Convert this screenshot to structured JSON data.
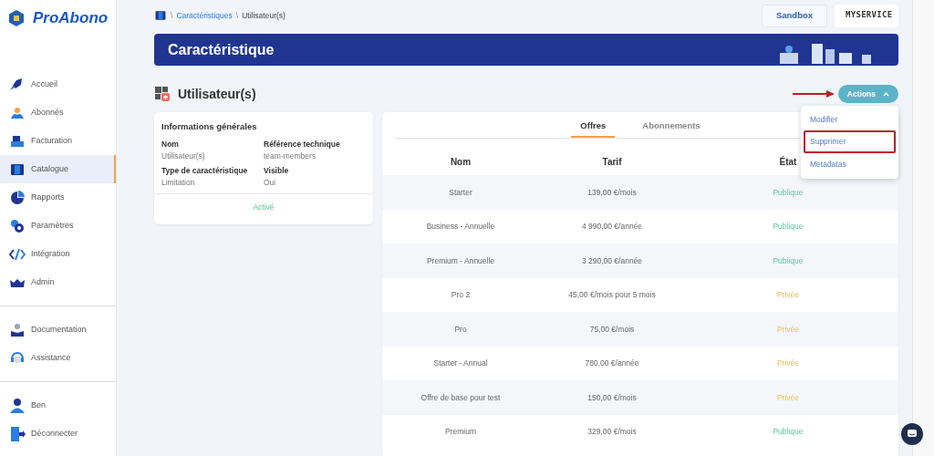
{
  "brand": "ProAbono",
  "sidebar": {
    "groups": [
      [
        {
          "label": "Accueil",
          "selected": false
        },
        {
          "label": "Abonnés",
          "selected": false
        },
        {
          "label": "Facturation",
          "selected": false
        },
        {
          "label": "Catalogue",
          "selected": true
        },
        {
          "label": "Rapports",
          "selected": false
        },
        {
          "label": "Paramètres",
          "selected": false
        },
        {
          "label": "Intégration",
          "selected": false
        },
        {
          "label": "Admin",
          "selected": false
        }
      ],
      [
        {
          "label": "Documentation",
          "selected": false
        },
        {
          "label": "Assistance",
          "selected": false
        }
      ],
      [
        {
          "label": "Ben",
          "selected": false
        },
        {
          "label": "Déconnecter",
          "selected": false
        }
      ]
    ]
  },
  "breadcrumb": [
    {
      "kind": "separator",
      "text": "\\"
    },
    {
      "kind": "link",
      "text": "Caractéristiques"
    },
    {
      "kind": "separator",
      "text": "\\"
    },
    {
      "kind": "current",
      "text": "Utilisateur(s)"
    }
  ],
  "header": {
    "sandbox": "Sandbox",
    "account": "MYSERVICE"
  },
  "banner": {
    "title": "Caractéristique"
  },
  "page_title": "Utilisateur(s)",
  "actions": {
    "label": "Actions",
    "expanded": true,
    "menu": [
      {
        "label": "Modifier",
        "highlighted": false
      },
      {
        "label": "Supprimer",
        "highlighted": true
      },
      {
        "label": "Metadatas",
        "highlighted": false
      }
    ]
  },
  "info_card": {
    "title": "Informations générales",
    "fields": [
      {
        "label": "Nom",
        "value": "Utilisateur(s)"
      },
      {
        "label": "Référence technique",
        "value": "team-members"
      },
      {
        "label": "Type de caractéristique",
        "value": "Limitation"
      },
      {
        "label": "Visible",
        "value": "Oui"
      }
    ],
    "footer": "Activé"
  },
  "tabs": [
    {
      "label": "Offres",
      "selected": true
    },
    {
      "label": "Abonnements",
      "selected": false
    }
  ],
  "table": {
    "columns": [
      "Nom",
      "Tarif",
      "État"
    ],
    "rows": [
      {
        "name": "Starter",
        "price": "139,00 €/mois",
        "status": "Publique",
        "kind": "public"
      },
      {
        "name": "Business - Annuelle",
        "price": "4 990,00 €/année",
        "status": "Publique",
        "kind": "public"
      },
      {
        "name": "Premium - Annuelle",
        "price": "3 290,00 €/année",
        "status": "Publique",
        "kind": "public"
      },
      {
        "name": "Pro 2",
        "price": "45,00 €/mois pour 5 mois",
        "status": "Privée",
        "kind": "private"
      },
      {
        "name": "Pro",
        "price": "75,00 €/mois",
        "status": "Privée",
        "kind": "private"
      },
      {
        "name": "Starter - Annual",
        "price": "780,00 €/année",
        "status": "Privée",
        "kind": "private"
      },
      {
        "name": "Offre de base pour test",
        "price": "150,00 €/mois",
        "status": "Privée",
        "kind": "private"
      },
      {
        "name": "Premium",
        "price": "329,00 €/mois",
        "status": "Publique",
        "kind": "public"
      }
    ]
  }
}
